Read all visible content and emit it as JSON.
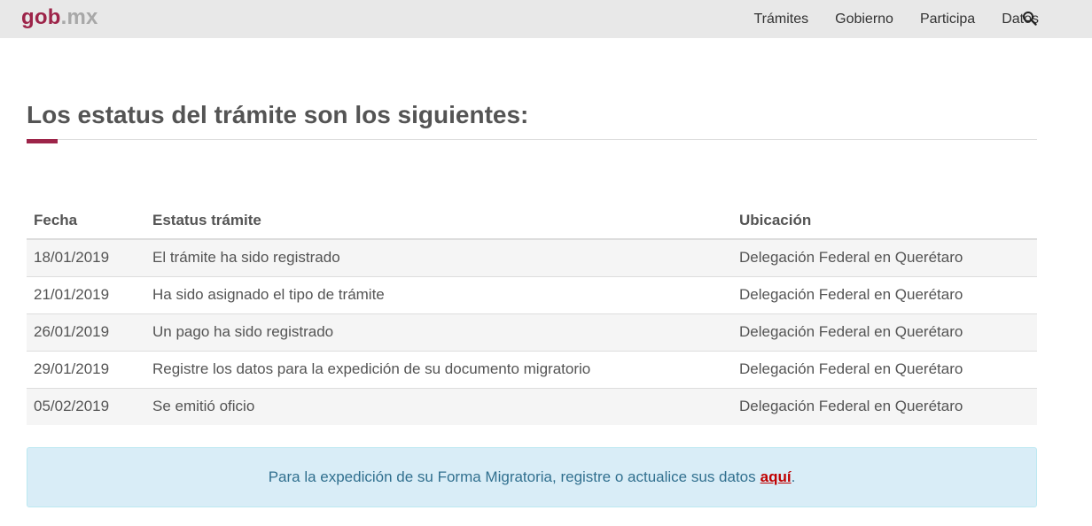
{
  "header": {
    "logo_gob": "gob",
    "logo_mx": ".mx",
    "nav": [
      "Trámites",
      "Gobierno",
      "Participa",
      "Datos"
    ],
    "search_icon": "search-icon"
  },
  "main": {
    "title": "Los estatus del trámite son los siguientes:",
    "table": {
      "headers": [
        "Fecha",
        "Estatus trámite",
        "Ubicación"
      ],
      "rows": [
        [
          "18/01/2019",
          "El trámite ha sido registrado",
          "Delegación Federal en Querétaro"
        ],
        [
          "21/01/2019",
          "Ha sido asignado el tipo de trámite",
          "Delegación Federal en Querétaro"
        ],
        [
          "26/01/2019",
          "Un pago ha sido registrado",
          "Delegación Federal en Querétaro"
        ],
        [
          "29/01/2019",
          "Registre los datos para la expedición de su documento migratorio",
          "Delegación Federal en Querétaro"
        ],
        [
          "05/02/2019",
          "Se emitió oficio",
          "Delegación Federal en Querétaro"
        ]
      ]
    },
    "notice": {
      "text": "Para la expedición de su Forma Migratoria, registre o actualice sus datos",
      "link": "aquí",
      "suffix": "."
    }
  },
  "colors": {
    "brand": "#9d2449",
    "link": "#c00000",
    "notice_bg": "#d9edf7"
  }
}
